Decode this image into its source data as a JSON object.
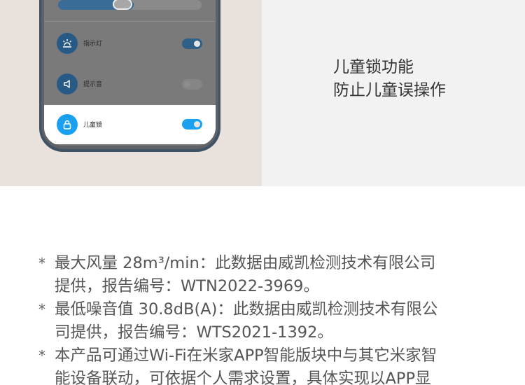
{
  "feature": {
    "title_line1": "儿童锁功能",
    "title_line2": "防止儿童误操作"
  },
  "settings": {
    "items": [
      {
        "label": "指示灯",
        "icon": "indicator-light-icon",
        "enabled": true
      },
      {
        "label": "提示音",
        "icon": "speaker-icon",
        "enabled": false
      },
      {
        "label": "儿童锁",
        "icon": "lock-icon",
        "enabled": true
      }
    ]
  },
  "notes": {
    "bullet": "*",
    "items": [
      {
        "line1": "最大风量 28m³/min：此数据由威凯检测技术有限公司",
        "line2": "提供，报告编号：WTN2022-3969。"
      },
      {
        "line1": "最低噪音值 30.8dB(A)：此数据由威凯检测技术有限公",
        "line2": "司提供，报告编号：WTS2021-1392。"
      },
      {
        "line1": "本产品可通过Wi-Fi在米家APP智能版块中与其它米家智",
        "line2": "能设备联动，可依据个人需求设置，具体实现以APP显"
      }
    ]
  },
  "colors": {
    "left_panel_bg": "#e8e1dc",
    "right_panel_bg": "#f2f2f2",
    "active_toggle": "#1aa0f0",
    "dimmed_toggle": "#2f6088"
  }
}
